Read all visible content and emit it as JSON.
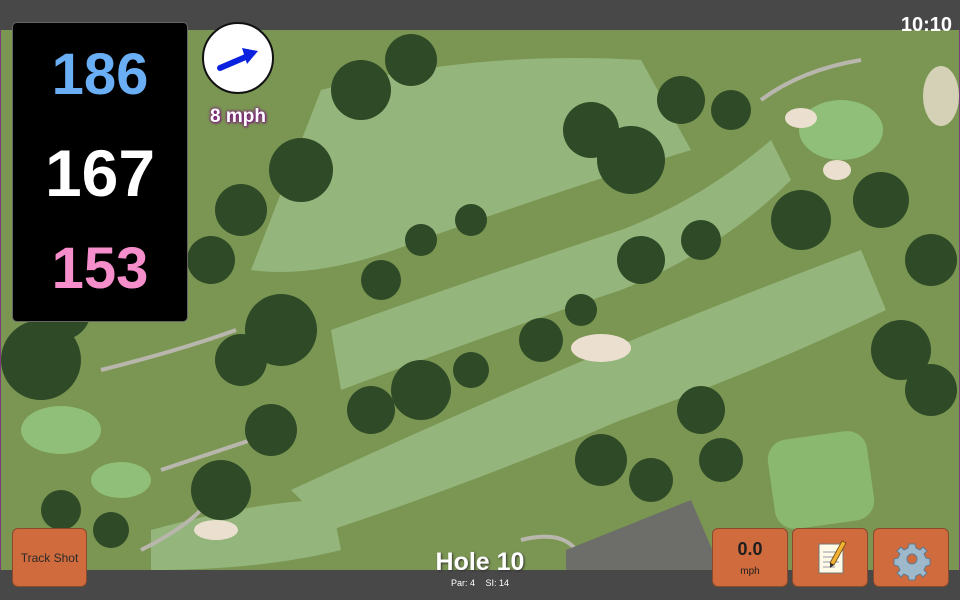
{
  "status": {
    "time": "10:10"
  },
  "yardages": {
    "back": "186",
    "center": "167",
    "front": "153",
    "colors": {
      "back": "#6aaef5",
      "center": "#ffffff",
      "front": "#f58ecb"
    }
  },
  "wind": {
    "speed": "8 mph",
    "icon": "wind-arrow-icon",
    "arrow_color": "#0a22e0"
  },
  "buttons": {
    "track_shot": "Track Shot",
    "speed_value": "0.0",
    "speed_unit": "mph",
    "notes_icon": "notepad-icon",
    "settings_icon": "gear-icon"
  },
  "hole": {
    "title": "Hole 10",
    "par": "Par: 4",
    "si": "SI: 14"
  },
  "colors": {
    "button": "#cf6b3d",
    "rough": "#7f9a56",
    "fairway": "#94b57b",
    "green": "#8fbf78",
    "sand": "#ebe0cf",
    "tree": "#2e4a26"
  }
}
